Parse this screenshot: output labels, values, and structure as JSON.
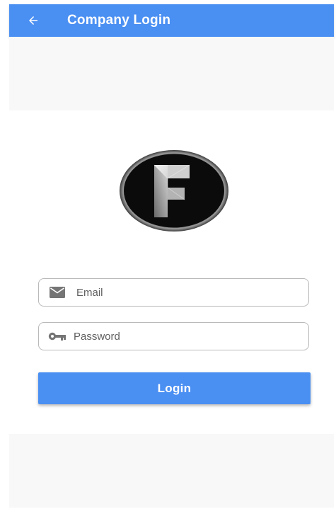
{
  "app_bar": {
    "title": "Company Login",
    "back_icon": "arrow-left-icon",
    "background_color": "#4a8ff2"
  },
  "logo": {
    "icon": "letter-f-logo-icon",
    "letter": "F"
  },
  "form": {
    "email": {
      "placeholder": "Email",
      "value": "",
      "icon": "mail-icon"
    },
    "password": {
      "placeholder": "Password",
      "value": "",
      "icon": "key-icon"
    },
    "login_label": "Login",
    "login_color": "#4a8ff2"
  }
}
